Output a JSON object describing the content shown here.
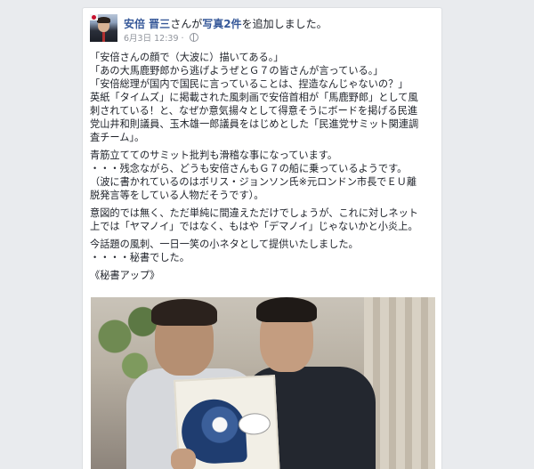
{
  "post": {
    "author": "安倍 晋三",
    "action_middle": "さんが",
    "action_link": "写真2件",
    "action_end": "を追加しました。",
    "date": "6月3日",
    "time": "12:39",
    "separator": "·",
    "privacy_icon": "globe-icon",
    "avatar_icon": "profile-photo"
  },
  "body": {
    "lines": [
      "「安倍さんの顔で（大波に）描いてある。」",
      "「あの大馬鹿野郎から逃げようぜとＧ７の皆さんが言っている。」",
      "「安倍総理が国内で国民に言っていることは、捏造なんじゃないの？」",
      "英紙「タイムズ」に掲載された風刺画で安倍首相が「馬鹿野郎」として風",
      "刺されている！と、なぜか意気揚々として得意そうにボードを掲げる民進",
      "党山井和則議員、玉木雄一郎議員をはじめとした「民進党サミット関連調",
      "査チーム」。",
      "",
      "青筋立ててのサミット批判も滑稽な事になっています。",
      "・・・残念ながら、どうも安倍さんもＧ７の船に乗っているようです。",
      "（波に書かれているのはボリス・ジョンソン氏※元ロンドン市長でＥＵ離",
      "脱発言等をしている人物だそうです）。",
      "",
      "意図的では無く、ただ単純に間違えただけでしょうが、これに対しネット",
      "上では「ヤマノイ」ではなく、もはや「デマノイ」じゃないかと小炎上。",
      "",
      "今話題の風刺、一日一笑の小ネタとして提供いたしました。",
      "・・・・秘書でした。",
      "",
      "《秘書アップ》"
    ]
  },
  "photo": {
    "description_icon": "photo-thumbnail"
  },
  "colors": {
    "link": "#365899",
    "text": "#1d2129",
    "meta": "#90949c",
    "background": "#e9ebee"
  }
}
